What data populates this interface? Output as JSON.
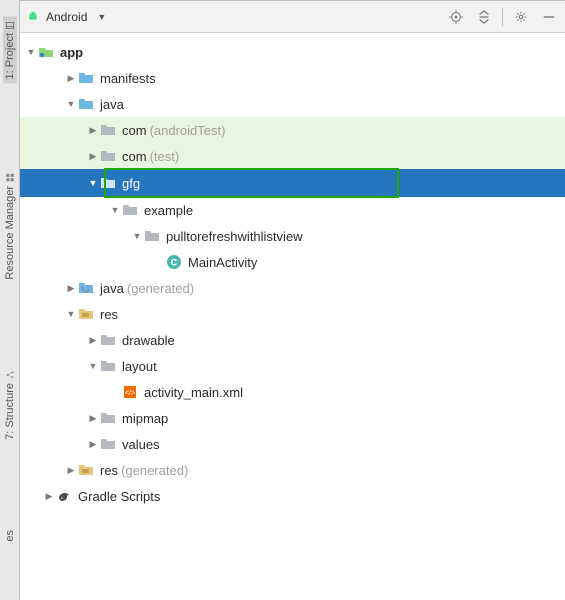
{
  "sidebar": {
    "tabs": [
      {
        "label": "1: Project"
      },
      {
        "label": "Resource Manager"
      },
      {
        "label": "7: Structure"
      },
      {
        "label": "es"
      }
    ]
  },
  "toolbar": {
    "view_label": "Android"
  },
  "tree": {
    "root": "app",
    "items": [
      {
        "label": "manifests",
        "indent": 1,
        "icon": "folder-blue",
        "expanded": false
      },
      {
        "label": "java",
        "indent": 1,
        "icon": "folder-blue",
        "expanded": true
      },
      {
        "label": "com",
        "suffix": "(androidTest)",
        "indent": 2,
        "icon": "folder-grey",
        "expanded": false,
        "green": true
      },
      {
        "label": "com",
        "suffix": "(test)",
        "indent": 2,
        "icon": "folder-grey",
        "expanded": false,
        "green": true
      },
      {
        "label": "gfg",
        "indent": 2,
        "icon": "folder-grey",
        "expanded": true,
        "selected": true
      },
      {
        "label": "example",
        "indent": 3,
        "icon": "folder-grey",
        "expanded": true
      },
      {
        "label": "pulltorefreshwithlistview",
        "indent": 4,
        "icon": "folder-grey",
        "expanded": true
      },
      {
        "label": "MainActivity",
        "indent": 5,
        "icon": "class-c",
        "leaf": true
      },
      {
        "label": "java",
        "suffix": "(generated)",
        "indent": 1,
        "icon": "folder-gen",
        "expanded": false
      },
      {
        "label": "res",
        "indent": 1,
        "icon": "folder-res",
        "expanded": true
      },
      {
        "label": "drawable",
        "indent": 2,
        "icon": "folder-grey",
        "expanded": false
      },
      {
        "label": "layout",
        "indent": 2,
        "icon": "folder-grey",
        "expanded": true
      },
      {
        "label": "activity_main.xml",
        "indent": 3,
        "icon": "xml",
        "leaf": true
      },
      {
        "label": "mipmap",
        "indent": 2,
        "icon": "folder-grey",
        "expanded": false
      },
      {
        "label": "values",
        "indent": 2,
        "icon": "folder-grey",
        "expanded": false
      },
      {
        "label": "res",
        "suffix": "(generated)",
        "indent": 1,
        "icon": "folder-res",
        "expanded": false
      },
      {
        "label": "Gradle Scripts",
        "indent": 0,
        "icon": "gradle",
        "expanded": false
      }
    ]
  }
}
